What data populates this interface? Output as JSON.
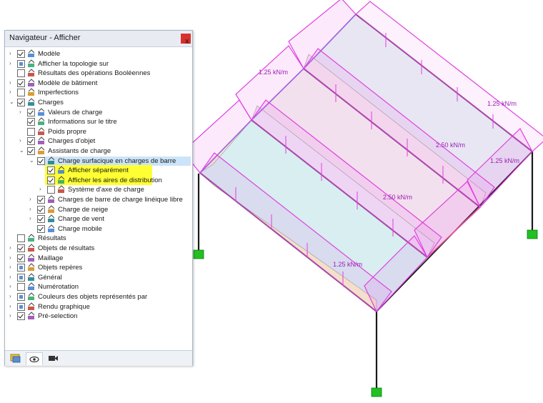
{
  "navigator": {
    "title": "Navigateur - Afficher",
    "close_label": "x",
    "items": [
      {
        "label": "Modèle",
        "level": 0,
        "expander": "›",
        "check": "on",
        "icon": "model-icon"
      },
      {
        "label": "Afficher la topologie sur",
        "level": 0,
        "expander": "›",
        "check": "part",
        "icon": "topology-icon"
      },
      {
        "label": "Résultats des opérations Booléennes",
        "level": 0,
        "expander": "",
        "check": "off",
        "icon": "boolean-icon"
      },
      {
        "label": "Modèle de bâtiment",
        "level": 0,
        "expander": "›",
        "check": "on",
        "icon": "building-icon"
      },
      {
        "label": "Imperfections",
        "level": 0,
        "expander": "›",
        "check": "off",
        "icon": "imperfection-icon"
      },
      {
        "label": "Charges",
        "level": 0,
        "expander": "⌄",
        "check": "on",
        "icon": "load-icon"
      },
      {
        "label": "Valeurs de charge",
        "level": 1,
        "expander": "›",
        "check": "on",
        "icon": "load-value-icon"
      },
      {
        "label": "Informations sur le titre",
        "level": 1,
        "expander": "",
        "check": "on",
        "icon": "title-info-icon"
      },
      {
        "label": "Poids propre",
        "level": 1,
        "expander": "",
        "check": "off",
        "icon": "self-weight-icon"
      },
      {
        "label": "Charges d'objet",
        "level": 1,
        "expander": "›",
        "check": "on",
        "icon": "object-load-icon"
      },
      {
        "label": "Assistants de charge",
        "level": 1,
        "expander": "⌄",
        "check": "on",
        "icon": "load-wizard-icon"
      },
      {
        "label": "Charge surfacique en charges de barre",
        "level": 2,
        "expander": "⌄",
        "check": "on",
        "icon": "surface-load-icon",
        "selected": true
      },
      {
        "label": "Afficher séparément",
        "level": 3,
        "expander": "",
        "check": "on",
        "icon": "separate-icon",
        "highlight": true
      },
      {
        "label": "Afficher les aires de distribution",
        "level": 3,
        "expander": "",
        "check": "on",
        "icon": "distribution-icon",
        "highlight": true
      },
      {
        "label": "Système d'axe de charge",
        "level": 3,
        "expander": "›",
        "check": "off",
        "icon": "axis-system-icon"
      },
      {
        "label": "Charges de barre de charge linéique libre",
        "level": 2,
        "expander": "›",
        "check": "on",
        "icon": "line-load-icon"
      },
      {
        "label": "Charge de neige",
        "level": 2,
        "expander": "›",
        "check": "on",
        "icon": "snow-icon"
      },
      {
        "label": "Charge de vent",
        "level": 2,
        "expander": "›",
        "check": "on",
        "icon": "wind-icon"
      },
      {
        "label": "Charge mobile",
        "level": 2,
        "expander": "",
        "check": "on",
        "icon": "mobile-load-icon"
      },
      {
        "label": "Résultats",
        "level": 0,
        "expander": "",
        "check": "off",
        "icon": "results-icon"
      },
      {
        "label": "Objets de résultats",
        "level": 0,
        "expander": "›",
        "check": "on",
        "icon": "result-objects-icon"
      },
      {
        "label": "Maillage",
        "level": 0,
        "expander": "›",
        "check": "on",
        "icon": "mesh-icon"
      },
      {
        "label": "Objets repères",
        "level": 0,
        "expander": "›",
        "check": "part",
        "icon": "guide-objects-icon"
      },
      {
        "label": "Général",
        "level": 0,
        "expander": "›",
        "check": "part",
        "icon": "general-icon"
      },
      {
        "label": "Numérotation",
        "level": 0,
        "expander": "›",
        "check": "off",
        "icon": "numbering-icon"
      },
      {
        "label": "Couleurs des objets représentés par",
        "level": 0,
        "expander": "›",
        "check": "part",
        "icon": "colors-icon"
      },
      {
        "label": "Rendu graphique",
        "level": 0,
        "expander": "›",
        "check": "part",
        "icon": "render-icon"
      },
      {
        "label": "Pré-selection",
        "level": 0,
        "expander": "›",
        "check": "on",
        "icon": "preselection-icon"
      }
    ],
    "tabs": [
      {
        "name": "tab-data",
        "icon": "data-tab-icon"
      },
      {
        "name": "tab-display",
        "icon": "eye-icon",
        "active": true
      },
      {
        "name": "tab-views",
        "icon": "camera-icon"
      }
    ]
  },
  "loads": {
    "label_1": "1.25 kN/m",
    "label_2": "1.25 kN/m",
    "label_3": "2.50 kN/m",
    "label_4": "1.25 kN/m",
    "label_5": "2.50 kN/m",
    "label_6": "1.25 kN/m"
  },
  "colors": {
    "load": "#e040e0",
    "support": "#22c022",
    "member": "#1a1a1a",
    "highlight": "#ffff33",
    "selection": "#cce4f7"
  }
}
